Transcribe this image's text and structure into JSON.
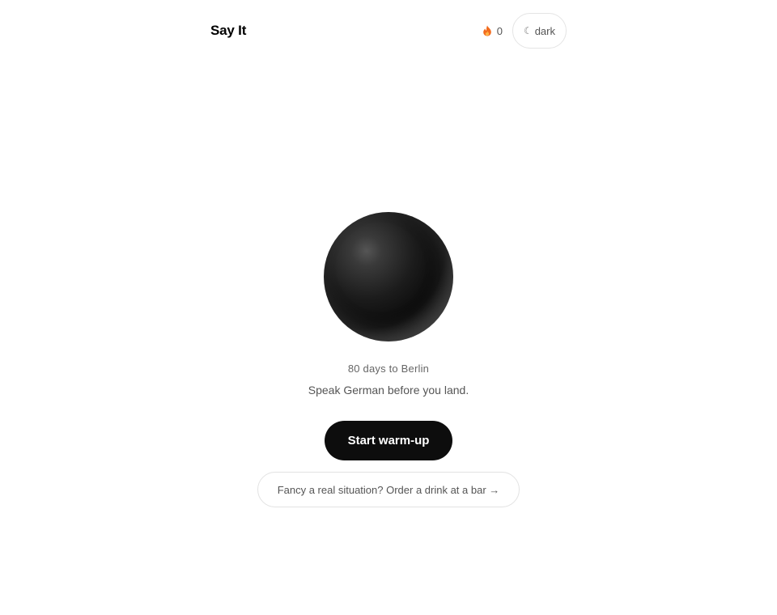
{
  "header": {
    "brand": "Say It",
    "streak": {
      "icon": "flame-icon",
      "count": "0"
    },
    "theme_toggle": {
      "icon": "moon-icon",
      "glyph": "☾",
      "label": "dark"
    }
  },
  "main": {
    "orb": {
      "icon": "voice-orb"
    },
    "countdown": "80 days to Berlin",
    "tagline": "Speak German before you land.",
    "primary_button": "Start warm-up",
    "scenario_link": "Fancy a real situation? Order a drink at a bar →"
  },
  "colors": {
    "background": "#ffffff",
    "primary_button_bg": "#0d0d0d",
    "primary_button_text": "#ffffff",
    "flame": "#f26b1d",
    "muted_text": "#555555",
    "border": "#e2e2e2"
  }
}
